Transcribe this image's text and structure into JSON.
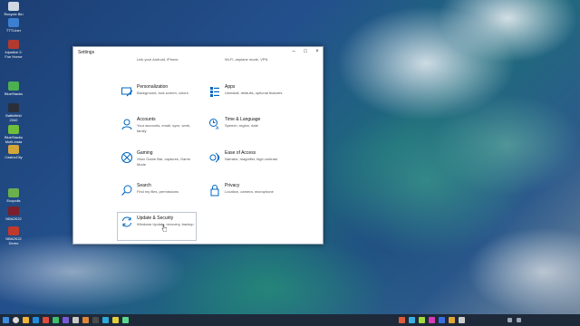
{
  "window": {
    "title": "Settings"
  },
  "settings_tiles": [
    {
      "name": "",
      "desc": "Link your Android, iPhone"
    },
    {
      "name": "",
      "desc": "Wi-Fi, airplane mode, VPN"
    },
    {
      "name": "Personalization",
      "desc": "Background, lock screen, colors"
    },
    {
      "name": "Apps",
      "desc": "Uninstall, defaults, optional features"
    },
    {
      "name": "Accounts",
      "desc": "Your accounts, email, sync, work, family"
    },
    {
      "name": "Time & Language",
      "desc": "Speech, region, date"
    },
    {
      "name": "Gaming",
      "desc": "Xbox Game Bar, captures, Game Mode"
    },
    {
      "name": "Ease of Access",
      "desc": "Narrator, magnifier, high contrast"
    },
    {
      "name": "Search",
      "desc": "Find my files, permissions"
    },
    {
      "name": "Privacy",
      "desc": "Location, camera, microphone"
    },
    {
      "name": "Update & Security",
      "desc": "Windows Update, recovery, backup"
    }
  ],
  "desktop_icons": [
    {
      "label": "Recycle Bin",
      "icon": "recycle-bin-icon"
    },
    {
      "label": "TTTLiber",
      "icon": "app-icon"
    },
    {
      "label": "Injustice 2: Fun Horror",
      "icon": "game-icon"
    },
    {
      "label": "BlueStacks",
      "icon": "app-icon"
    },
    {
      "label": "Battlefield 2042",
      "icon": "game-icon"
    },
    {
      "label": "BlueStacks Multi-Insta",
      "icon": "app-icon"
    },
    {
      "label": "CasinoCity",
      "icon": "game-icon"
    },
    {
      "label": "Ecopolis",
      "icon": "game-icon"
    },
    {
      "label": "NBA2K22",
      "icon": "game-icon"
    },
    {
      "label": "NBA2K22 Demo",
      "icon": "game-icon"
    }
  ],
  "colors": {
    "accent": "#0067c0",
    "taskbar": "#1e2a3a"
  }
}
